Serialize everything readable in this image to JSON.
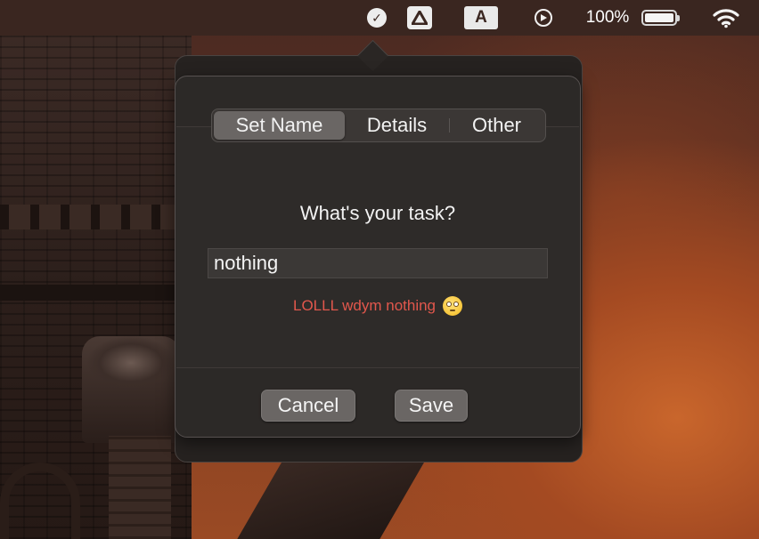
{
  "menubar": {
    "battery_percent": "100%",
    "a_icon_label": "A",
    "icons": [
      "check-circle-icon",
      "drive-icon",
      "input-source-icon",
      "play-circle-icon",
      "battery-icon",
      "wifi-icon"
    ]
  },
  "dialog": {
    "tabs": [
      {
        "label": "Set Name",
        "selected": true
      },
      {
        "label": "Details",
        "selected": false
      },
      {
        "label": "Other",
        "selected": false
      }
    ],
    "prompt": "What's your task?",
    "task_input": {
      "value": "nothing",
      "placeholder": ""
    },
    "feedback": "LOLLL wdym nothing",
    "feedback_emoji": "flushed-face",
    "cancel_label": "Cancel",
    "save_label": "Save"
  },
  "colors": {
    "feedback": "#e2574c",
    "menubar": "#3a2620",
    "dialog_bg": "#2c2927",
    "selected_tab": "#6a6664"
  }
}
